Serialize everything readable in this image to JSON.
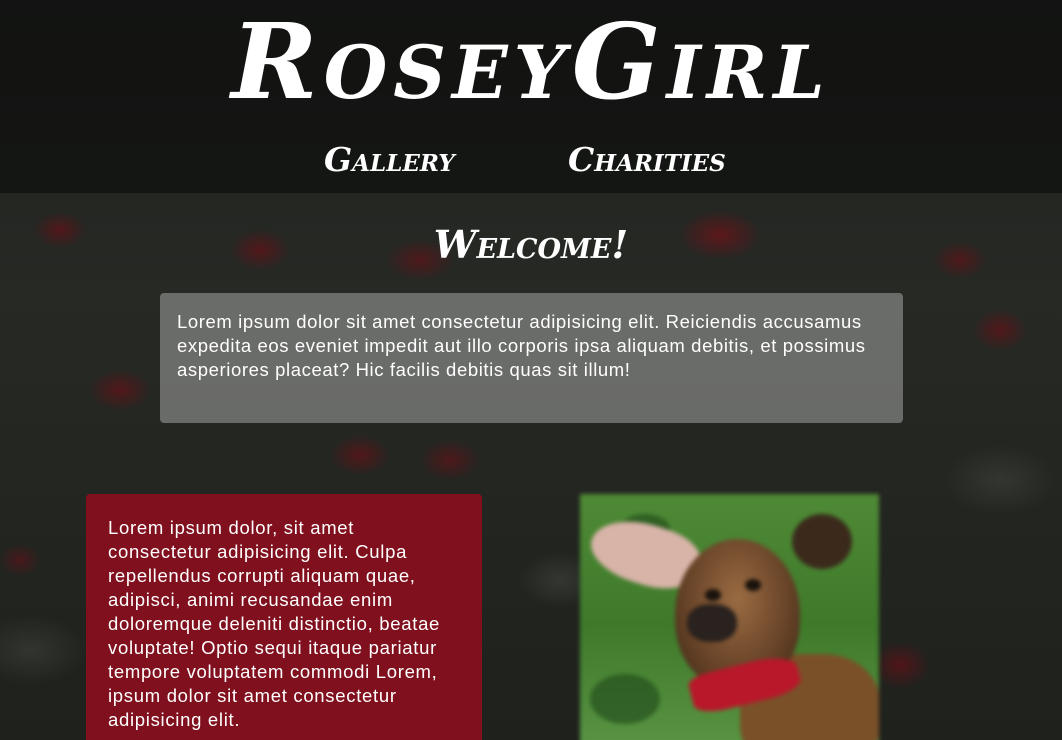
{
  "header": {
    "logo": "RoseyGirl"
  },
  "nav": {
    "items": [
      {
        "label": "Gallery"
      },
      {
        "label": "Charities"
      }
    ]
  },
  "main": {
    "heading": "Welcome!",
    "intro_text": "Lorem ipsum dolor sit amet consectetur adipisicing elit. Reiciendis accusamus expedita eos eveniet impedit aut illo corporis ipsa aliquam debitis, et possimus asperiores placeat? Hic facilis debitis quas sit illum!",
    "side_text": "Lorem ipsum dolor, sit amet consectetur adipisicing elit. Culpa repellendus corrupti aliquam quae, adipisci, animi recusandae enim doloremque deleniti distinctio, beatae voluptate! Optio sequi itaque pariatur tempore voluptatem commodi Lorem, ipsum dolor sit amet consectetur adipisicing elit."
  },
  "colors": {
    "accent": "#960c1e",
    "header_overlay": "#000000",
    "text": "#ffffff"
  },
  "icons": {
    "photo": "dog-photo"
  }
}
